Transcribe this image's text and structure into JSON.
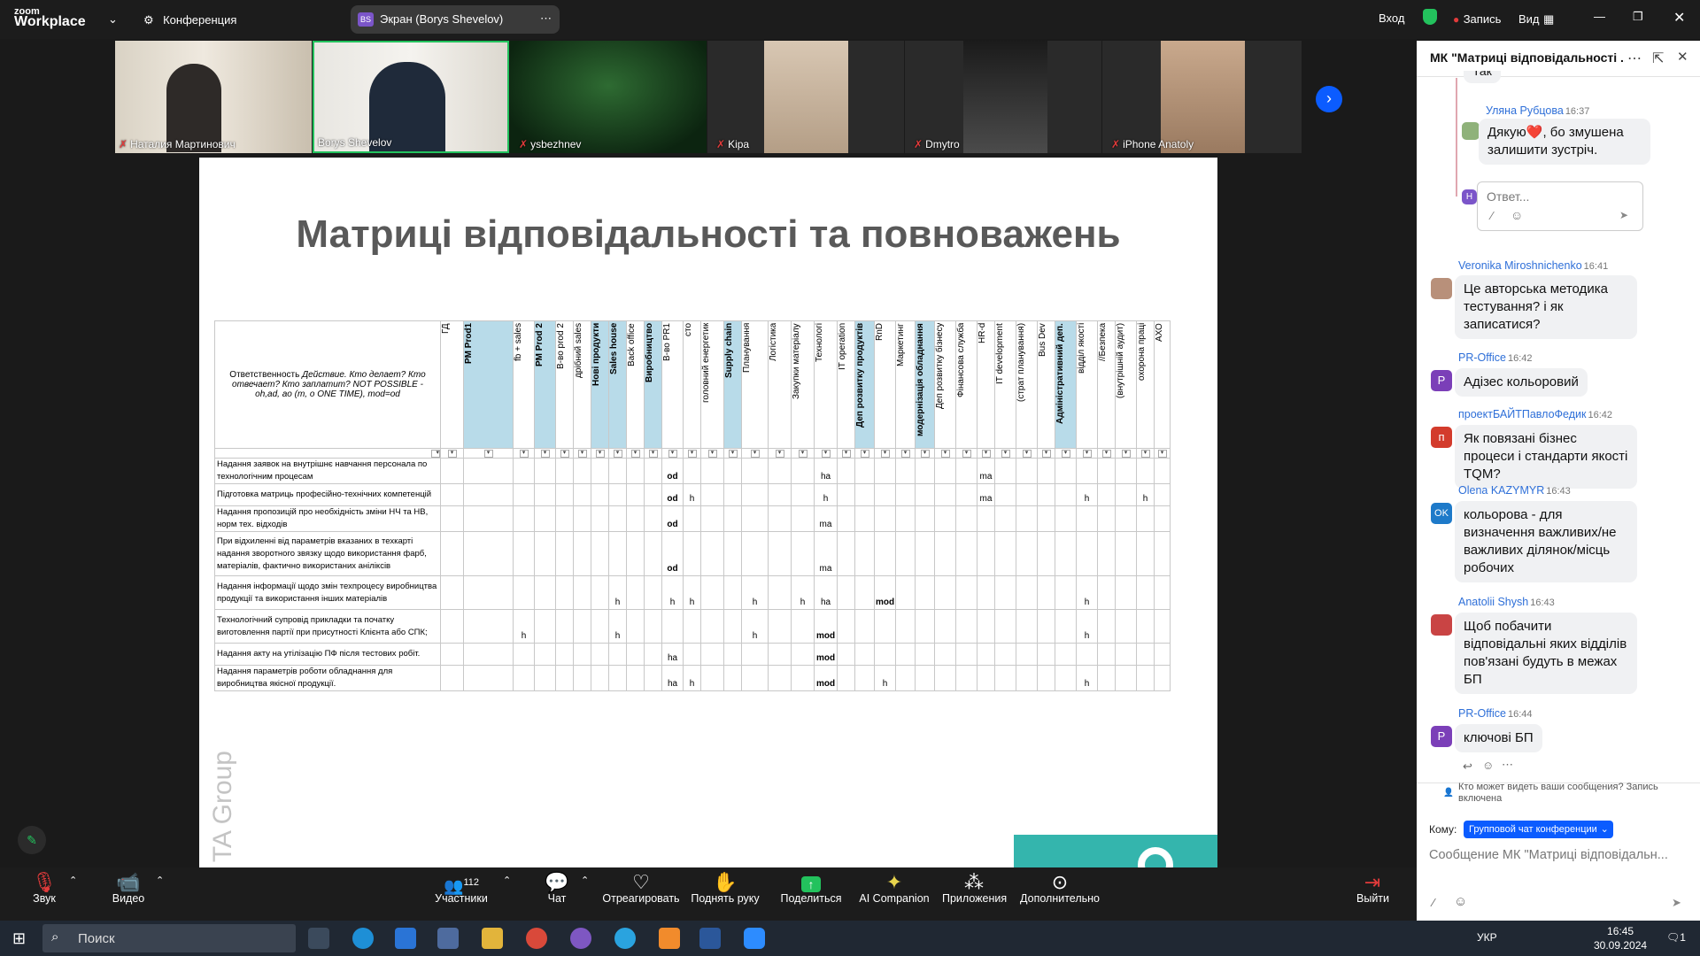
{
  "app": {
    "logo_line1": "zoom",
    "logo_line2": "Workplace",
    "meeting_label": "Конференция"
  },
  "share_pill": {
    "initials": "BS",
    "label": "Экран (Borys Shevelov)"
  },
  "topright": {
    "signin": "Вход",
    "record": "Запись",
    "view": "Вид"
  },
  "thumbnails": [
    {
      "name": "Наталия Мартинович"
    },
    {
      "name": "Borys Shevelov"
    },
    {
      "name": "ysbezhnev"
    },
    {
      "name": "Kipa"
    },
    {
      "name": "Dmytro"
    },
    {
      "name": "iPhone Anatoly"
    }
  ],
  "slide": {
    "title": "Матриці відповідальності та повноважень",
    "responsibility_header": "Ответственность",
    "responsibility_italic": "Действие. Кто делает? Кто отвечает? Кто заплатит? NOT POSSIBLE - oh,ad, ao (m, o ONE TIME), mod=od",
    "columns": [
      "ГД",
      "PM Prod1",
      "fb + sales",
      "PM Prod 2",
      "В-во prod 2",
      "дрібний sales",
      "Нові продукти",
      "Sales house",
      "Back office",
      "Виробництво",
      "В-во PR1",
      "сто",
      "головний енергетик",
      "Supply chain",
      "Планування",
      "Логістика",
      "Закупки матеріалу",
      "Технологі",
      "IT operation",
      "Деп розвитку продуктів",
      "RnD",
      "Маркетинг",
      "модернізація обладнання",
      "Деп розвитку бізнесу",
      "Фінансова служба",
      "HR-d",
      "IT development",
      "(страт планування)",
      "Bus Dev",
      "Адміністративний деп.",
      "відділ якості",
      "//Безпека",
      "(внутрішній аудит)",
      "охорона праці",
      "AХО"
    ],
    "rows": [
      {
        "task": "Надання заявок  на внутрішнє навчання персонала по технологічним процесам",
        "cells": {
          "10": "od",
          "17": "ha",
          "25": "ma"
        }
      },
      {
        "task": "Підготовка матриць професійно-технічних компетенцій",
        "cells": {
          "10": "od",
          "11": "h",
          "17": "h",
          "25": "ma",
          "30": "h",
          "33": "h"
        }
      },
      {
        "task": "Надання пропозицій про необхідність зміни НЧ та НВ, норм тех. відходів",
        "cells": {
          "10": "od",
          "17": "ma"
        }
      },
      {
        "task": "При відхиленні від параметрів вказаних в техкарті надання зворотного звязку  щодо використання фарб, матеріалів, фактично використаних  аніліксів",
        "cells": {
          "10": "od",
          "17": "ma"
        }
      },
      {
        "task": "Надання інформації щодо змін техпроцесу виробництва продукції та використання інших матеріалів",
        "cells": {
          "7": "h",
          "10": "h",
          "11": "h",
          "14": "h",
          "16": "h",
          "17": "ha",
          "20": "mod",
          "30": "h"
        }
      },
      {
        "task": "Технологічний супровід прикладки та початку виготовлення партії при присутності Клієнта або СПК;",
        "cells": {
          "2": "h",
          "7": "h",
          "14": "h",
          "17": "mod",
          "30": "h"
        }
      },
      {
        "task": "Надання акту на утілізацію ПФ після тестових робіт.",
        "cells": {
          "10": "ha",
          "17": "mod"
        }
      },
      {
        "task": "Надання параметрів роботи обладнання для виробництва якісної продукції.",
        "cells": {
          "10": "ha",
          "11": "h",
          "17": "mod",
          "20": "h",
          "30": "h"
        }
      }
    ],
    "watermark": "TA Group"
  },
  "chat": {
    "title": "МК \"Матриці відповідальності ...",
    "prev_tail": "Так",
    "messages": [
      {
        "sender": "Уляна Рубцова",
        "time": "16:37",
        "text": "Дякую❤️, бо змушена залишити зустріч."
      },
      {
        "sender": "Veronika Miroshnichenko",
        "time": "16:41",
        "text": "Це авторська методика тестування? і як записатися?"
      },
      {
        "sender": "PR-Office",
        "time": "16:42",
        "text": "Адізес кольоровий"
      },
      {
        "sender": "проектБАЙТПавлоФедик",
        "time": "16:42",
        "text": "Як повязані бізнес процеси і стандарти якості TQM?"
      },
      {
        "sender": "Olena KAZYMYR",
        "time": "16:43",
        "text": "кольорова - для визначення важливих/не важливих ділянок/місць робочих"
      },
      {
        "sender": "Anatolii Shysh",
        "time": "16:43",
        "text": "Щоб побачити відповідальні яких відділів пов'язані будуть в межах БП"
      },
      {
        "sender": "PR-Office",
        "time": "16:44",
        "text": "ключові БП"
      }
    ],
    "reply_placeholder": "Ответ...",
    "reply_initial": "H",
    "visibility_note": "Кто может видеть ваши сообщения? Запись включена",
    "to_label": "Кому:",
    "to_value": "Групповой чат конференции",
    "input_placeholder": "Сообщение МК \"Матриці відповідальн..."
  },
  "toolbar": {
    "audio": "Звук",
    "video": "Видео",
    "participants": "Участники",
    "participants_count": "112",
    "chat": "Чат",
    "react": "Отреагировать",
    "raise": "Поднять руку",
    "share": "Поделиться",
    "ai": "AI Companion",
    "apps": "Приложения",
    "more": "Дополнительно",
    "leave": "Выйти"
  },
  "taskbar": {
    "search": "Поиск",
    "lang": "УКР",
    "time": "16:45",
    "date": "30.09.2024",
    "notif": "1"
  },
  "colors": {
    "accent_blue": "#0b5cff",
    "chat_name": "#2e6fd8",
    "header_blue": "#b8dbe9",
    "record_red": "#e23b3b",
    "share_green": "#23c25d"
  }
}
